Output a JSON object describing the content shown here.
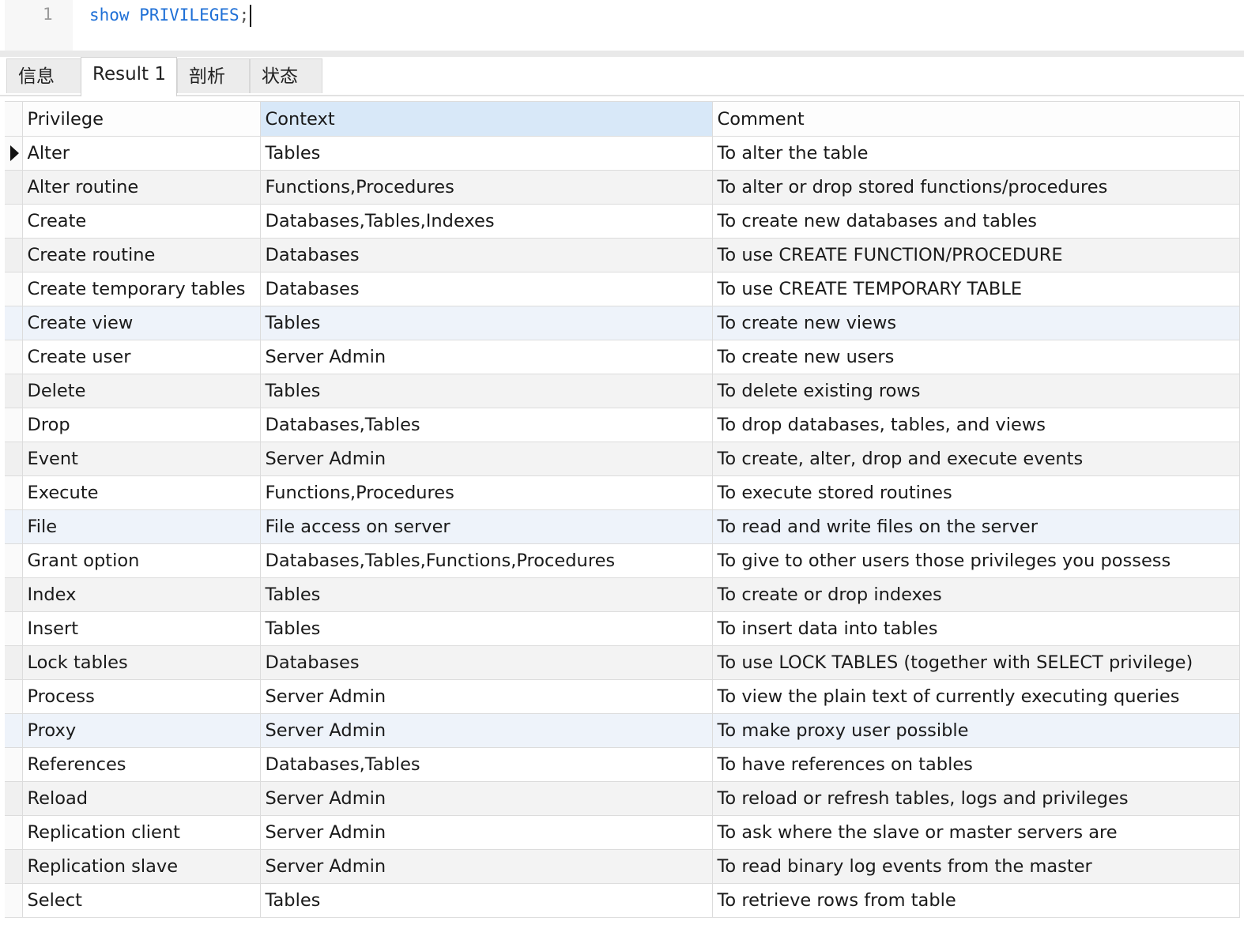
{
  "editor": {
    "line_number": "1",
    "code_keyword": "show PRIVILEGES",
    "code_punct": ";"
  },
  "tabs": [
    {
      "label": "信息"
    },
    {
      "label": "Result 1"
    },
    {
      "label": "剖析"
    },
    {
      "label": "状态"
    }
  ],
  "grid": {
    "columns": [
      "Privilege",
      "Context",
      "Comment"
    ],
    "rows": [
      [
        "Alter",
        "Tables",
        "To alter the table"
      ],
      [
        "Alter routine",
        "Functions,Procedures",
        "To alter or drop stored functions/procedures"
      ],
      [
        "Create",
        "Databases,Tables,Indexes",
        "To create new databases and tables"
      ],
      [
        "Create routine",
        "Databases",
        "To use CREATE FUNCTION/PROCEDURE"
      ],
      [
        "Create temporary tables",
        "Databases",
        "To use CREATE TEMPORARY TABLE"
      ],
      [
        "Create view",
        "Tables",
        "To create new views"
      ],
      [
        "Create user",
        "Server Admin",
        "To create new users"
      ],
      [
        "Delete",
        "Tables",
        "To delete existing rows"
      ],
      [
        "Drop",
        "Databases,Tables",
        "To drop databases, tables, and views"
      ],
      [
        "Event",
        "Server Admin",
        "To create, alter, drop and execute events"
      ],
      [
        "Execute",
        "Functions,Procedures",
        "To execute stored routines"
      ],
      [
        "File",
        "File access on server",
        "To read and write files on the server"
      ],
      [
        "Grant option",
        "Databases,Tables,Functions,Procedures",
        "To give to other users those privileges you possess"
      ],
      [
        "Index",
        "Tables",
        "To create or drop indexes"
      ],
      [
        "Insert",
        "Tables",
        "To insert data into tables"
      ],
      [
        "Lock tables",
        "Databases",
        "To use LOCK TABLES (together with SELECT privilege)"
      ],
      [
        "Process",
        "Server Admin",
        "To view the plain text of currently executing queries"
      ],
      [
        "Proxy",
        "Server Admin",
        "To make proxy user possible"
      ],
      [
        "References",
        "Databases,Tables",
        "To have references on tables"
      ],
      [
        "Reload",
        "Server Admin",
        "To reload or refresh tables, logs and privileges"
      ],
      [
        "Replication client",
        "Server Admin",
        "To ask where the slave or master servers are"
      ],
      [
        "Replication slave",
        "Server Admin",
        "To read binary log events from the master"
      ],
      [
        "Select",
        "Tables",
        "To retrieve rows from table"
      ]
    ]
  }
}
